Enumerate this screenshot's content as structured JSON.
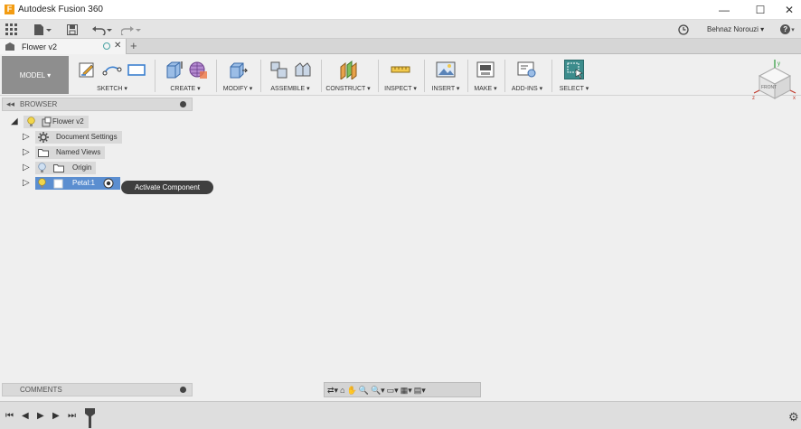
{
  "window": {
    "title": "Autodesk Fusion 360",
    "logo_letter": "F",
    "minimize": "—",
    "maximize": "☐",
    "close": "✕"
  },
  "quick_access": {
    "user_name": "Behnaz Norouzi ▾",
    "help_label": "?▾"
  },
  "tabs": [
    {
      "label": "Flower v2",
      "close": "✕"
    }
  ],
  "tab_add": "+",
  "toolbar": {
    "workspace": "MODEL ▾",
    "groups": [
      {
        "label": "SKETCH ▾",
        "icons": [
          "sketch-icon",
          "line-icon",
          "rectangle-icon"
        ]
      },
      {
        "label": "CREATE ▾",
        "icons": [
          "extrude-icon",
          "mesh-sphere-icon"
        ]
      },
      {
        "label": "MODIFY ▾",
        "icons": [
          "press-pull-icon"
        ]
      },
      {
        "label": "ASSEMBLE ▾",
        "icons": [
          "new-component-icon",
          "joint-icon"
        ]
      },
      {
        "label": "CONSTRUCT ▾",
        "icons": [
          "offset-plane-icon"
        ]
      },
      {
        "label": "INSPECT ▾",
        "icons": [
          "measure-icon"
        ]
      },
      {
        "label": "INSERT ▾",
        "icons": [
          "insert-image-icon"
        ]
      },
      {
        "label": "MAKE ▾",
        "icons": [
          "3d-print-icon"
        ]
      },
      {
        "label": "ADD-INS ▾",
        "icons": [
          "scripts-icon"
        ]
      },
      {
        "label": "SELECT ▾",
        "icons": [
          "select-icon"
        ]
      }
    ]
  },
  "viewcube": {
    "label_x": "x",
    "label_y": "y",
    "label_z": "z",
    "face": "FRONT"
  },
  "browser": {
    "title": "BROWSER",
    "collapse": "◂◂",
    "items": [
      {
        "label": "Flower v2",
        "arrow": "◢"
      },
      {
        "label": "Document Settings",
        "arrow": "▷"
      },
      {
        "label": "Named Views",
        "arrow": "▷"
      },
      {
        "label": "Origin",
        "arrow": "▷"
      },
      {
        "label": "Petal:1",
        "arrow": "▷"
      }
    ]
  },
  "tooltip": "Activate Component",
  "comments": {
    "title": "COMMENTS"
  },
  "navbar": {
    "items": [
      "⇄▾",
      "⌂",
      "✋",
      "🔍",
      "🔍▾",
      "▭▾",
      "▦▾",
      "▤▾"
    ]
  },
  "timeline": {
    "first": "⏮",
    "prev": "◀",
    "play": "▶",
    "next": "▶",
    "last": "⏭",
    "settings": "⚙"
  },
  "colors": {
    "selected": "#5b8ed0",
    "accent": "#f39c12",
    "select_active": "#3c8c8c"
  }
}
